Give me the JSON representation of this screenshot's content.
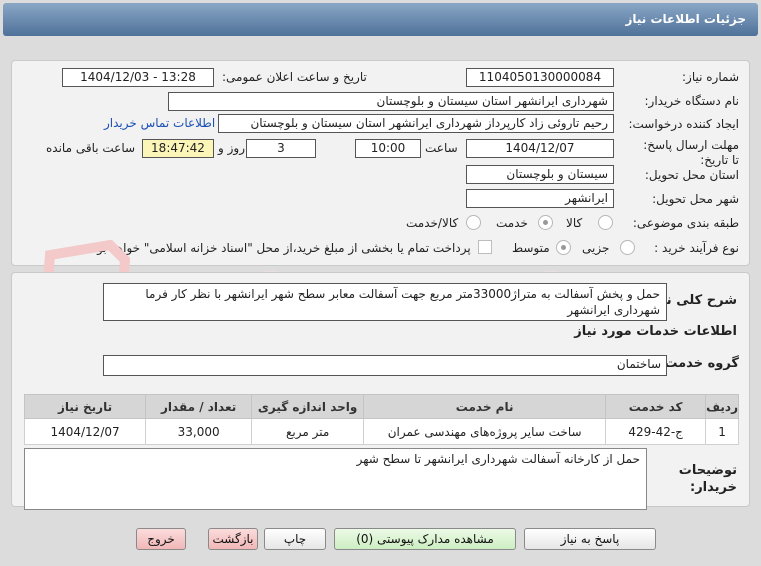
{
  "window": {
    "title": "جزئیات اطلاعات نیاز"
  },
  "form": {
    "need_number_label": "شماره نیاز:",
    "need_number": "1104050130000084",
    "announce_label": "تاریخ و ساعت اعلان عمومی:",
    "announce_value": "1404/12/03 - 13:28",
    "buyer_org_label": "نام دستگاه خریدار:",
    "buyer_org": "شهرداری ایرانشهر استان سیستان و بلوچستان",
    "creator_label": "ایجاد کننده درخواست:",
    "creator": "رحیم تاروئی زاد کارپرداز شهرداری ایرانشهر استان سیستان و بلوچستان",
    "contact_link": "اطلاعات تماس خریدار",
    "deadline_label": "مهلت ارسال پاسخ: تا تاریخ:",
    "deadline_date": "1404/12/07",
    "time_label": "ساعت",
    "deadline_time": "10:00",
    "days_value": "3",
    "days_label": "روز و",
    "remaining_time": "18:47:42",
    "remaining_label": "ساعت باقی مانده",
    "province_label": "استان محل تحویل:",
    "province": "سیستان و بلوچستان",
    "city_label": "شهر محل تحویل:",
    "city": "ایرانشهر",
    "category_label": "طبقه بندی موضوعی:",
    "category_options": [
      "کالا",
      "خدمت",
      "کالا/خدمت"
    ],
    "process_label": "نوع فرآیند خرید :",
    "process_options": [
      "جزیی",
      "متوسط"
    ],
    "payment_note": "پرداخت تمام یا بخشی از مبلغ خرید،از محل \"اسناد خزانه اسلامی\" خواهد بود."
  },
  "description": {
    "label": "شرح کلی نیاز:",
    "text": "حمل و پخش آسفالت به متراژ33000متر مربع جهت آسفالت معابر سطح شهر ایرانشهر با نظر کار فرما شهرداری ایرانشهر"
  },
  "services": {
    "section_title": "اطلاعات خدمات مورد نیاز",
    "group_label": "گروه خدمت:",
    "group_value": "ساختمان",
    "table": {
      "headers": [
        "ردیف",
        "کد خدمت",
        "نام خدمت",
        "واحد اندازه گیری",
        "تعداد / مقدار",
        "تاریخ نیاز"
      ],
      "rows": [
        [
          "1",
          "ج-42-429",
          "ساخت سایر پروژه‌های مهندسی عمران",
          "متر مربع",
          "33,000",
          "1404/12/07"
        ]
      ]
    }
  },
  "buyer_notes": {
    "label": "توضیحات خریدار:",
    "text": "حمل از کارخانه آسفالت شهرداری ایرانشهر تا سطح شهر"
  },
  "buttons": {
    "reply": "پاسخ به نیاز",
    "attachments": "مشاهده مدارک پیوستی (0)",
    "print": "چاپ",
    "back": "بازگشت",
    "exit": "خروج"
  },
  "watermark": {
    "text": "AriaTender.net"
  }
}
